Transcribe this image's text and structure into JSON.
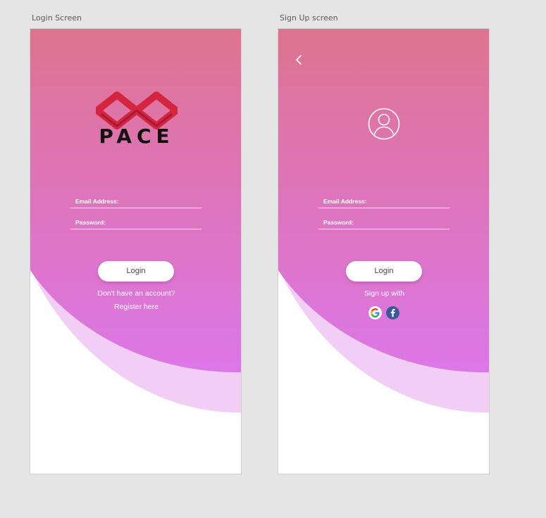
{
  "login_screen": {
    "artboard_label": "Login Screen",
    "logo_text": "PACE",
    "email_label": "Email Address:",
    "password_label": "Password:",
    "login_button": "Login",
    "no_account_text": "Don't have an account?",
    "register_link": "Register here"
  },
  "signup_screen": {
    "artboard_label": "Sign Up screen",
    "email_label": "Email Address:",
    "password_label": "Password:",
    "login_button": "Login",
    "sign_up_with": "Sign up with",
    "icons": [
      "back-icon",
      "user-avatar-icon",
      "google-icon",
      "facebook-icon"
    ]
  },
  "colors": {
    "gradient_top": "#de7390",
    "gradient_bottom": "#dd76e8",
    "wave_light": "#f2cdf5",
    "logo_red": "#d4243f",
    "facebook_blue": "#3b5998"
  }
}
